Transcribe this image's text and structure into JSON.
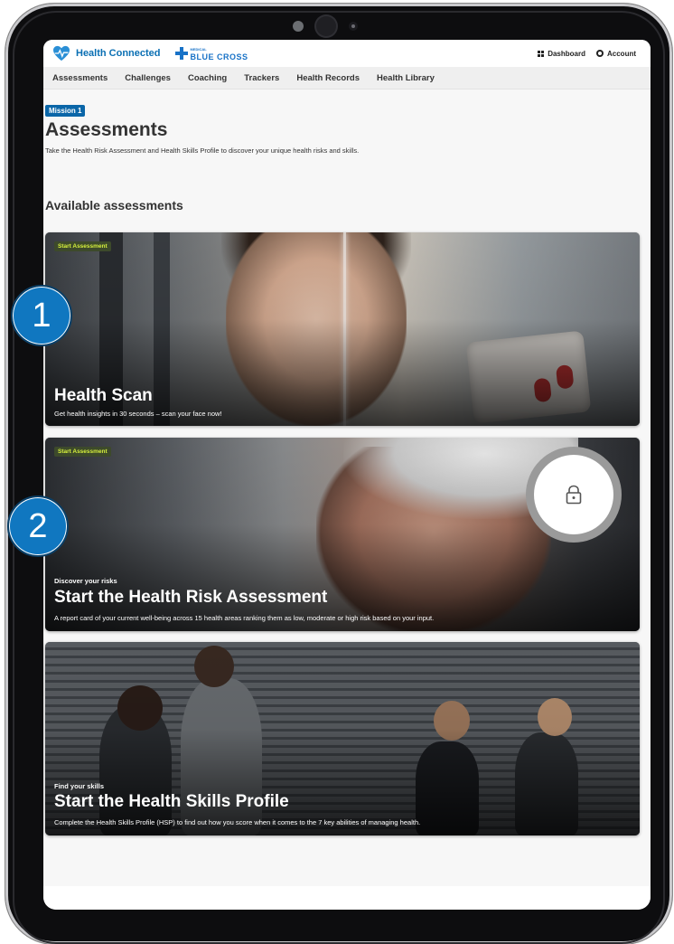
{
  "header": {
    "brand": "Health Connected",
    "partner_small": "MEDICAL",
    "partner": "BLUE CROSS",
    "dashboard_label": "Dashboard",
    "account_label": "Account"
  },
  "nav": {
    "items": [
      "Assessments",
      "Challenges",
      "Coaching",
      "Trackers",
      "Health Records",
      "Health Library"
    ]
  },
  "page": {
    "badge": "Mission 1",
    "title": "Assessments",
    "subtitle": "Take the Health Risk Assessment and Health Skills Profile to discover your unique health risks and skills.",
    "section_title": "Available assessments"
  },
  "cards": [
    {
      "tag": "Start Assessment",
      "title": "Health Scan",
      "description": "Get health insights in 30 seconds – scan your face now!"
    },
    {
      "tag": "Start Assessment",
      "kicker": "Discover your risks",
      "title": "Start the Health Risk Assessment",
      "description": "A report card of your current well-being across 15 health areas ranking them as low, moderate or high risk based on your input.",
      "locked": true
    },
    {
      "kicker": "Find your skills",
      "title": "Start the Health Skills Profile",
      "description": "Complete the Health Skills Profile (HSP) to find out how you score when it comes to the 7 key abilities of managing health."
    }
  ],
  "callouts": [
    "1",
    "2"
  ],
  "colors": {
    "brand_blue": "#0a6fb3",
    "badge_blue": "#0a66a8",
    "tag_text": "#d6f03c",
    "callout_blue": "#1077c0"
  }
}
